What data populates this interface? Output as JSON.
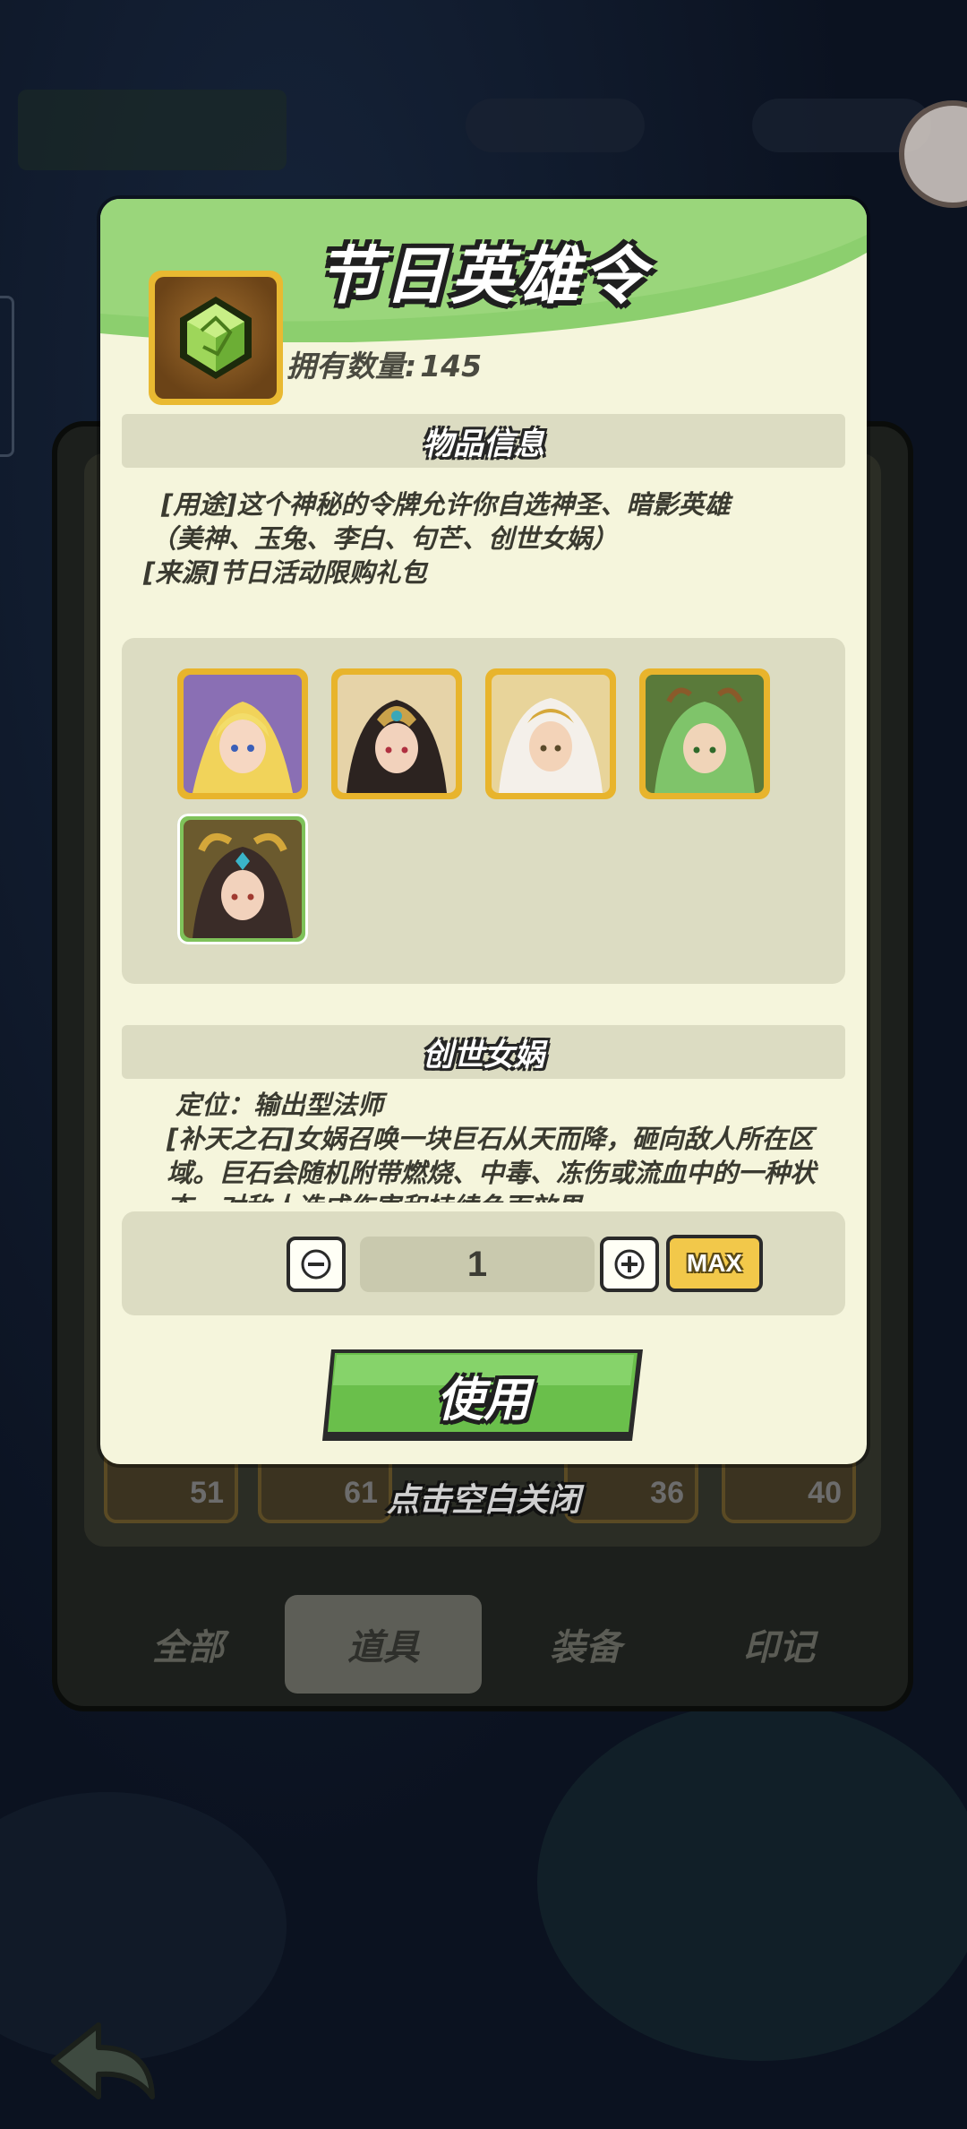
{
  "dialog": {
    "title": "节日英雄令",
    "owned_label": "拥有数量:",
    "owned_count": "145",
    "item_icon": "green-gem-token-icon",
    "item_info_header": "物品信息",
    "description_lines": [
      "[用途]这个神秘的令牌允许你自选神圣、暗影英雄",
      "（美神、玉兔、李白、句芒、创世女娲）",
      "[来源]节日活动限购礼包"
    ],
    "heroes": [
      {
        "name": "美神",
        "selected": false
      },
      {
        "name": "玉兔",
        "selected": false
      },
      {
        "name": "李白",
        "selected": false
      },
      {
        "name": "句芒",
        "selected": false
      },
      {
        "name": "创世女娲",
        "selected": true
      }
    ],
    "selected_hero_name": "创世女娲",
    "selected_hero_desc": [
      "定位：输出型法师",
      "[补天之石]女娲召唤一块巨石从天而降，砸向敌人所在区域。巨石会随机附带燃烧、中毒、冻伤或流血中的一种状态，对敌人造成伤害和持续负面效果。"
    ],
    "quantity": "1",
    "max_label": "MAX",
    "use_label": "使用",
    "close_hint": "点击空白关闭"
  },
  "background": {
    "tabs": [
      "全部",
      "道具",
      "装备",
      "印记"
    ],
    "active_tab": "道具",
    "slot_counts": [
      "51",
      "61",
      "36",
      "40"
    ]
  },
  "colors": {
    "dialog_bg": "#f5f5dc",
    "header_green": "#8ccf6e",
    "use_green": "#6abf4b",
    "gold_frame": "#e8b42c",
    "selected_frame": "#7fc25a"
  }
}
